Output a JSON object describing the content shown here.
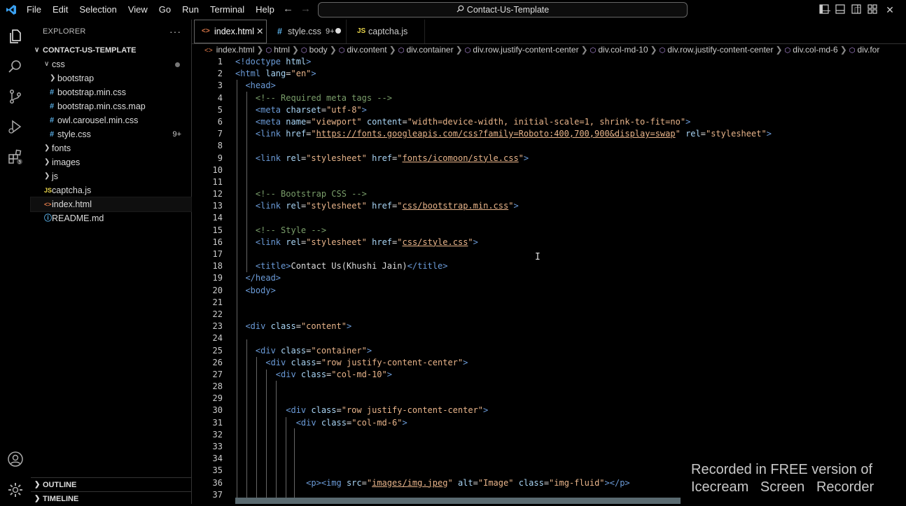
{
  "menu": [
    "File",
    "Edit",
    "Selection",
    "View",
    "Go",
    "Run",
    "Terminal",
    "Help"
  ],
  "command_center": "Contact-Us-Template",
  "explorer": {
    "title": "EXPLORER",
    "root": "CONTACT-US-TEMPLATE",
    "items": [
      {
        "label": "css",
        "depth": 1,
        "kind": "folder-open"
      },
      {
        "label": "bootstrap",
        "depth": 2,
        "kind": "folder"
      },
      {
        "label": "bootstrap.min.css",
        "depth": 2,
        "kind": "css"
      },
      {
        "label": "bootstrap.min.css.map",
        "depth": 2,
        "kind": "css"
      },
      {
        "label": "owl.carousel.min.css",
        "depth": 2,
        "kind": "css"
      },
      {
        "label": "style.css",
        "depth": 2,
        "kind": "css",
        "badge": "9+"
      },
      {
        "label": "fonts",
        "depth": 1,
        "kind": "folder"
      },
      {
        "label": "images",
        "depth": 1,
        "kind": "folder"
      },
      {
        "label": "js",
        "depth": 1,
        "kind": "folder"
      },
      {
        "label": "captcha.js",
        "depth": 1,
        "kind": "js"
      },
      {
        "label": "index.html",
        "depth": 1,
        "kind": "html",
        "selected": true
      },
      {
        "label": "README.md",
        "depth": 1,
        "kind": "info"
      }
    ],
    "outline": "OUTLINE",
    "timeline": "TIMELINE"
  },
  "tabs": [
    {
      "label": "index.html",
      "icon": "html-file-icon",
      "active": true
    },
    {
      "label": "style.css",
      "badge": "9+",
      "icon": "css-file-icon"
    },
    {
      "label": "captcha.js",
      "icon": "js-file-icon"
    }
  ],
  "breadcrumb": [
    "index.html",
    "html",
    "body",
    "div.content",
    "div.container",
    "div.row.justify-content-center",
    "div.col-md-10",
    "div.row.justify-content-center",
    "div.col-md-6",
    "div.for"
  ],
  "line_numbers": [
    "1",
    "2",
    "3",
    "4",
    "5",
    "6",
    "7",
    "8",
    "9",
    "10",
    "11",
    "12",
    "13",
    "14",
    "15",
    "16",
    "17",
    "18",
    "19",
    "20",
    "21",
    "22",
    "23",
    "24",
    "25",
    "26",
    "27",
    "28",
    "29",
    "30",
    "31",
    "32",
    "33",
    "34",
    "35",
    "36",
    "37"
  ],
  "code": {
    "l1a": "<!doctype ",
    "l1b": "html",
    "l1c": ">",
    "l2a": "<html ",
    "l2b": "lang",
    "l2c": "=",
    "l2d": "\"en\"",
    "l2e": ">",
    "l3": "<head>",
    "l4": "<!-- Required meta tags -->",
    "l5a": "<meta ",
    "l5b": "charset",
    "l5d": "\"utf-8\"",
    "l6b": "name",
    "l6d": "\"viewport\"",
    "l6f": "content",
    "l6g": "\"width=device-width, initial-scale=1, shrink-to-fit=no\"",
    "l7a": "<link ",
    "l7b": "href",
    "l7q1": "\"",
    "l7u": "https://fonts.googleapis.com/css?family=Roboto:400,700,900&display=swap",
    "l7q2": "\"",
    "l7r": "rel",
    "l7s": "\"stylesheet\"",
    "l9r": "rel",
    "l9s": "\"stylesheet\"",
    "l9h": "href",
    "l9u": "fonts/icomoon/style.css",
    "l12": "<!-- Bootstrap CSS -->",
    "l13u": "css/bootstrap.min.css",
    "l15": "<!-- Style -->",
    "l16u": "css/style.css",
    "l18a": "<title>",
    "l18b": "Contact Us(Khushi Jain)",
    "l18c": "</title>",
    "l19": "</head>",
    "l20": "<body>",
    "l23a": "<div ",
    "l23b": "class",
    "l23s": "\"content\"",
    "l25s": "\"container\"",
    "l26s": "\"row justify-content-center\"",
    "l27s": "\"col-md-10\"",
    "l30s": "\"row justify-content-center\"",
    "l31s": "\"col-md-6\"",
    "l36a": "<p><img ",
    "l36b": "src",
    "l36u": "images/img.jpeg",
    "l36c": "alt",
    "l36d": "\"Image\"",
    "l36e": "class",
    "l36f": "\"img-fluid\"",
    "l36g": "></p>"
  },
  "watermark": [
    "Recorded in FREE version of",
    "Icecream   Screen   Recorder"
  ]
}
